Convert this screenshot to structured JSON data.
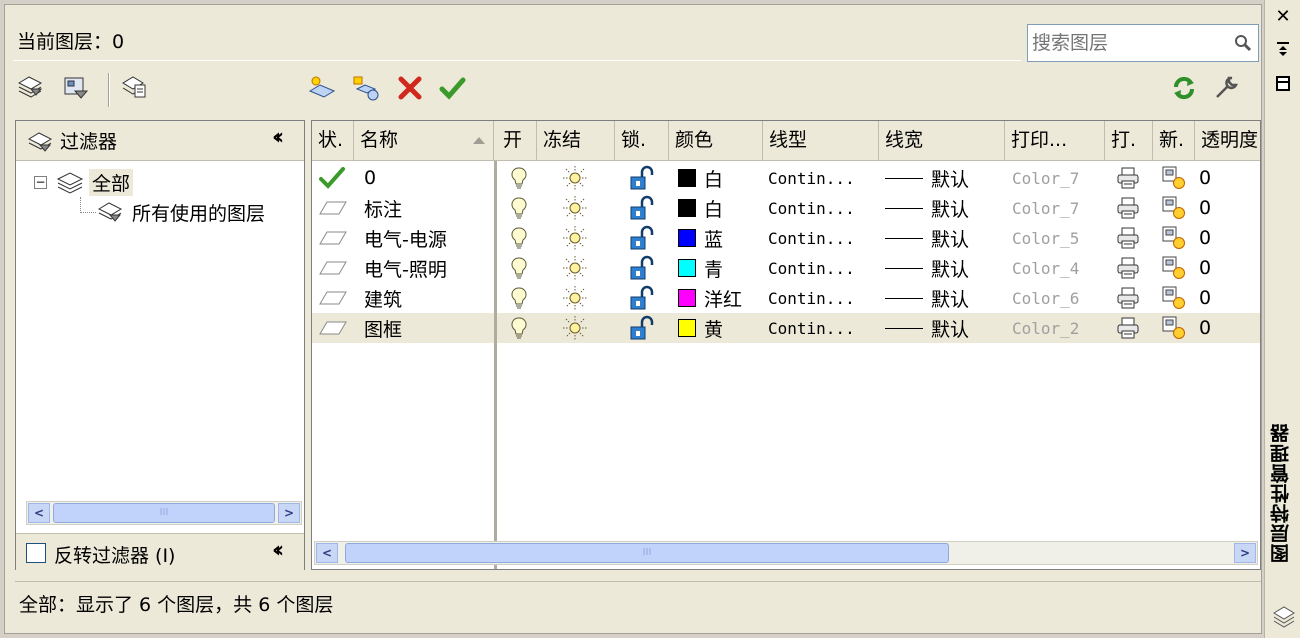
{
  "header": {
    "current_layer_label": "当前图层：0",
    "search_placeholder": "搜索图层"
  },
  "filter_panel": {
    "title": "过滤器",
    "tree": {
      "root": "全部",
      "child": "所有使用的图层"
    },
    "invert_label": "反转过滤器 (I)",
    "scroll_thumb": "III"
  },
  "columns": {
    "status": "状.",
    "name": "名称",
    "on": "开",
    "freeze": "冻结",
    "lock": "锁.",
    "color": "颜色",
    "linetype": "线型",
    "lineweight": "线宽",
    "plot_style": "打印...",
    "plot": "打.",
    "new_vp": "新.",
    "transparency": "透明度"
  },
  "layers": [
    {
      "name": "0",
      "current": true,
      "color_name": "白",
      "color_hex": "#000000",
      "linetype": "Contin...",
      "lineweight": "默认",
      "plot_style": "Color_7",
      "transparency": "0"
    },
    {
      "name": "标注",
      "current": false,
      "color_name": "白",
      "color_hex": "#000000",
      "linetype": "Contin...",
      "lineweight": "默认",
      "plot_style": "Color_7",
      "transparency": "0"
    },
    {
      "name": "电气-电源",
      "current": false,
      "color_name": "蓝",
      "color_hex": "#0000ff",
      "linetype": "Contin...",
      "lineweight": "默认",
      "plot_style": "Color_5",
      "transparency": "0"
    },
    {
      "name": "电气-照明",
      "current": false,
      "color_name": "青",
      "color_hex": "#00ffff",
      "linetype": "Contin...",
      "lineweight": "默认",
      "plot_style": "Color_4",
      "transparency": "0"
    },
    {
      "name": "建筑",
      "current": false,
      "color_name": "洋红",
      "color_hex": "#ff00ff",
      "linetype": "Contin...",
      "lineweight": "默认",
      "plot_style": "Color_6",
      "transparency": "0"
    },
    {
      "name": "图框",
      "current": false,
      "color_name": "黄",
      "color_hex": "#ffff00",
      "linetype": "Contin...",
      "lineweight": "默认",
      "plot_style": "Color_2",
      "transparency": "0"
    }
  ],
  "grid_scroll_thumb": "III",
  "status_text": "全部：显示了 6 个图层，共 6 个图层",
  "sidebar": {
    "title": "图层特性管理器",
    "close": "✕"
  }
}
